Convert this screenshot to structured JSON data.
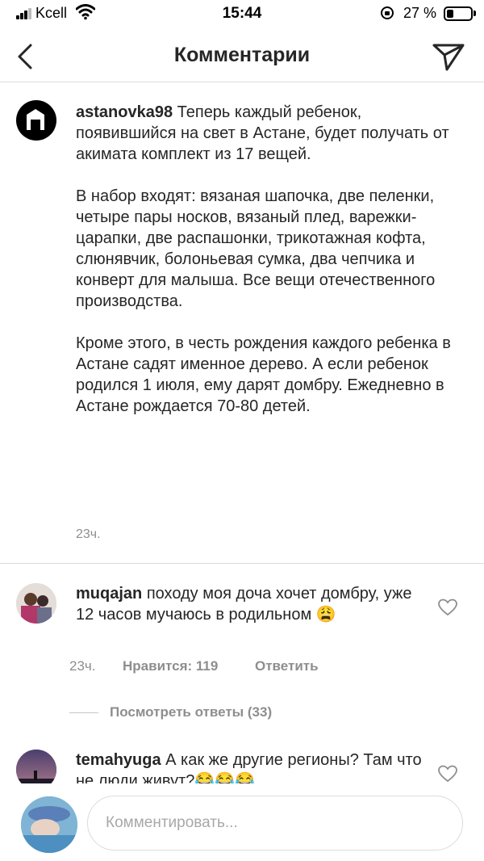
{
  "status": {
    "carrier": "Kcell",
    "time": "15:44",
    "battery_percent": "27 %",
    "battery_level": 0.27
  },
  "header": {
    "title": "Комментарии"
  },
  "caption": {
    "username": "astanovka98",
    "paragraphs": [
      "Теперь каждый ребенок, появившийся на свет в Астане, будет получать от акимата комплект из 17 вещей.",
      "В набор входят: вязаная шапочка, две пеленки, четыре пары носков, вязаный плед, варежки-царапки, две распашонки, трикотажная кофта, слюнявчик, болоньевая сумка, два чепчика и конверт для малыша. Все вещи отечественного производства.",
      "Кроме этого, в честь рождения каждого ребенка в Астане садят именное дерево. А если ребенок родился 1 июля, ему дарят домбру. Ежедневно в Астане рождается 70-80 детей."
    ],
    "time": "23ч."
  },
  "comments": [
    {
      "username": "muqajan",
      "text": "походу моя доча хочет домбру, уже 12 часов мучаюсь в родильном 😩",
      "time": "23ч.",
      "likes_label": "Нравится: 119",
      "reply_label": "Ответить",
      "view_replies": "Посмотреть ответы (33)"
    },
    {
      "username": "temahyuga",
      "text": "А как же другие регионы? Там что не люди живут?😂😂😂"
    }
  ],
  "input": {
    "placeholder": "Комментировать..."
  },
  "icons": {
    "back": "chevron-left-icon",
    "send": "paper-plane-icon",
    "like": "heart-outline-icon"
  }
}
